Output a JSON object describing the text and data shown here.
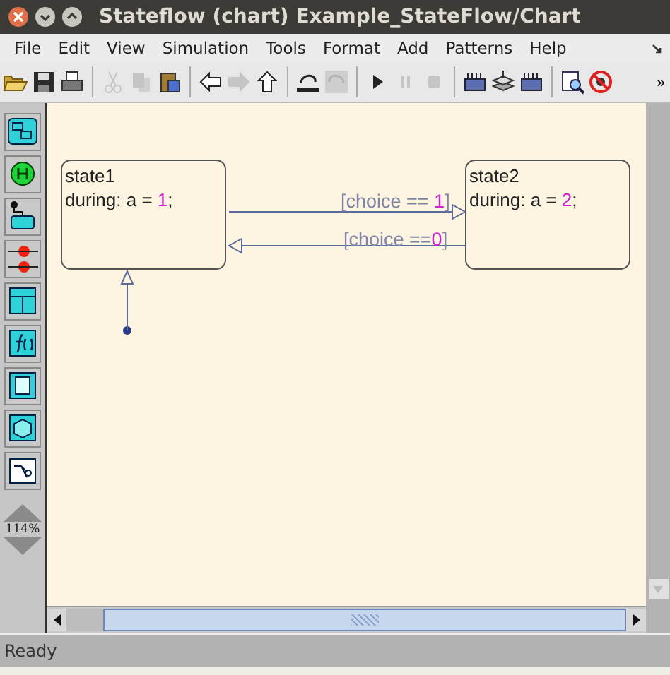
{
  "window": {
    "title": "Stateflow (chart) Example_StateFlow/Chart"
  },
  "menu": [
    "File",
    "Edit",
    "View",
    "Simulation",
    "Tools",
    "Format",
    "Add",
    "Patterns",
    "Help"
  ],
  "toolbar": [
    {
      "kind": "open",
      "disabled": false
    },
    {
      "kind": "save",
      "disabled": false
    },
    {
      "kind": "print",
      "disabled": false
    },
    {
      "kind": "sep"
    },
    {
      "kind": "cut",
      "disabled": true
    },
    {
      "kind": "copy",
      "disabled": true
    },
    {
      "kind": "paste",
      "disabled": false
    },
    {
      "kind": "sep"
    },
    {
      "kind": "back",
      "disabled": false
    },
    {
      "kind": "forward",
      "disabled": true
    },
    {
      "kind": "up",
      "disabled": false
    },
    {
      "kind": "sep"
    },
    {
      "kind": "undo",
      "disabled": false
    },
    {
      "kind": "redo",
      "disabled": true
    },
    {
      "kind": "sep"
    },
    {
      "kind": "play",
      "disabled": false
    },
    {
      "kind": "pause",
      "disabled": true
    },
    {
      "kind": "stop",
      "disabled": true
    },
    {
      "kind": "sep"
    },
    {
      "kind": "build",
      "disabled": false
    },
    {
      "kind": "stack",
      "disabled": false
    },
    {
      "kind": "build",
      "disabled": false
    },
    {
      "kind": "sep"
    },
    {
      "kind": "explore",
      "disabled": false
    },
    {
      "kind": "nodebug",
      "disabled": false
    }
  ],
  "toolbar_overflow": "»",
  "palette": [
    {
      "kind": "state"
    },
    {
      "kind": "history"
    },
    {
      "kind": "default"
    },
    {
      "kind": "junction"
    },
    {
      "kind": "truth"
    },
    {
      "kind": "function"
    },
    {
      "kind": "matlab"
    },
    {
      "kind": "box"
    },
    {
      "kind": "simulink"
    }
  ],
  "zoom": {
    "reading": "114%"
  },
  "states": [
    {
      "name": "state1",
      "action": [
        {
          "text": "during: a = "
        },
        {
          "text": "1",
          "kind": "value"
        },
        {
          "text": ";"
        }
      ]
    },
    {
      "name": "state2",
      "action": [
        {
          "text": "during: a = "
        },
        {
          "text": "2",
          "kind": "value"
        },
        {
          "text": ";"
        }
      ]
    }
  ],
  "transitions": [
    {
      "label": [
        {
          "text": "[choice == "
        },
        {
          "text": "1",
          "kind": "value"
        },
        {
          "text": "]"
        }
      ]
    },
    {
      "label": [
        {
          "text": "[choice =="
        },
        {
          "text": "0",
          "kind": "value"
        },
        {
          "text": "]"
        }
      ]
    }
  ],
  "status_bar": "Ready"
}
